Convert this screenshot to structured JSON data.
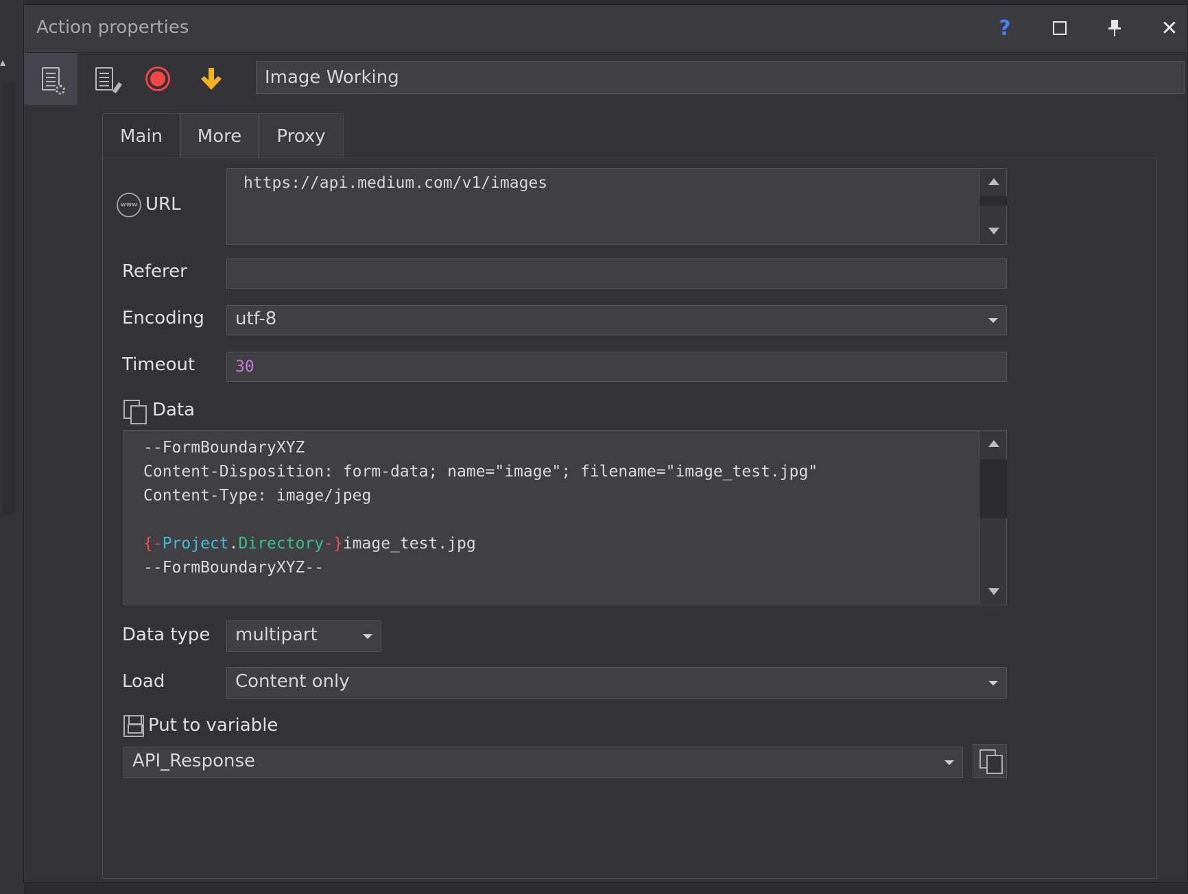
{
  "window": {
    "title": "Action properties",
    "help_glyph": "?",
    "close_glyph": "✕",
    "pin_glyph": "📌"
  },
  "toolbar": {
    "action_name": "Image Working",
    "down_glyph": "🡇"
  },
  "tabs": [
    {
      "label": "Main",
      "active": true
    },
    {
      "label": "More",
      "active": false
    },
    {
      "label": "Proxy",
      "active": false
    }
  ],
  "form": {
    "url": {
      "label": "URL",
      "icon_text": "www",
      "value": "https://api.medium.com/v1/images"
    },
    "referer": {
      "label": "Referer",
      "value": ""
    },
    "encoding": {
      "label": "Encoding",
      "value": "utf-8"
    },
    "timeout": {
      "label": "Timeout",
      "value": "30"
    },
    "data": {
      "label": "Data",
      "lines": [
        "--FormBoundaryXYZ",
        "Content-Disposition: form-data; name=\"image\"; filename=\"image_test.jpg\"",
        "Content-Type: image/jpeg",
        "",
        "--FormBoundaryXYZ--"
      ],
      "template_line": {
        "open": "{-",
        "project": "Project",
        "dot": ".",
        "directory": "Directory",
        "close": "-}",
        "suffix": "image_test.jpg"
      }
    },
    "data_type": {
      "label": "Data type",
      "value": "multipart"
    },
    "load": {
      "label": "Load",
      "value": "Content only"
    },
    "put_to_variable": {
      "label": "Put to variable",
      "value": "API_Response"
    }
  },
  "colors": {
    "help": "#3f86f4",
    "record": "#f04646",
    "down_arrow": "#f2b21f",
    "timeout_value": "#c77ad8",
    "macro_brace": "#ef4f4f",
    "macro_project": "#3cc0d9",
    "macro_directory": "#36c48a"
  }
}
